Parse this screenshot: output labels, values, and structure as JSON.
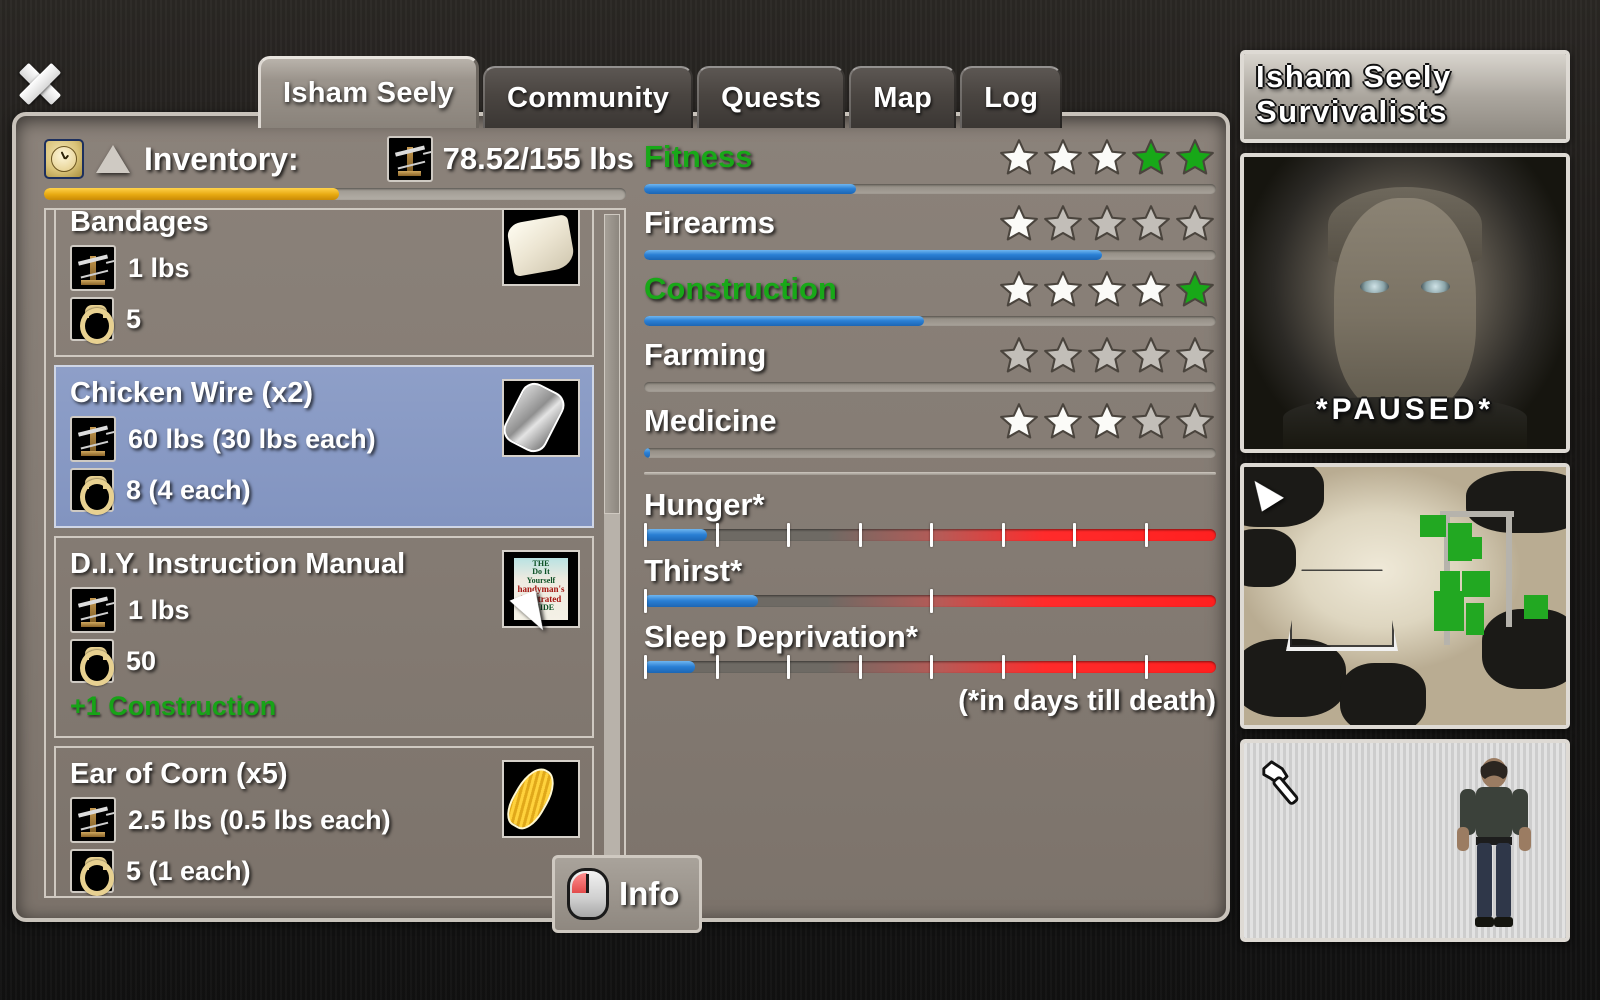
{
  "window": {
    "close_label": "close-window"
  },
  "tabs": [
    {
      "label": "Isham Seely",
      "active": true
    },
    {
      "label": "Community",
      "active": false
    },
    {
      "label": "Quests",
      "active": false
    },
    {
      "label": "Map",
      "active": false
    },
    {
      "label": "Log",
      "active": false
    }
  ],
  "inventory": {
    "title": "Inventory:",
    "weight_text": "78.52/155 lbs",
    "weight_current": 78.52,
    "weight_max": 155,
    "weight_percent": 50.7,
    "clock_icon": "clock-icon",
    "sort_icon": "sort-triangle-icon",
    "scale_icon": "scale-icon",
    "items": [
      {
        "name": "Bandages",
        "weight": "1 lbs",
        "value": "5",
        "bonus": "",
        "thumb": "bandage-thumb",
        "selected": false
      },
      {
        "name": "Chicken Wire (x2)",
        "weight": "60 lbs (30 lbs each)",
        "value": "8 (4 each)",
        "bonus": "",
        "thumb": "chicken-wire-thumb",
        "selected": true
      },
      {
        "name": "D.I.Y. Instruction Manual",
        "weight": "1 lbs",
        "value": "50",
        "bonus": "+1 Construction",
        "thumb": "manual-thumb",
        "selected": false
      },
      {
        "name": "Ear of Corn (x5)",
        "weight": "2.5 lbs (0.5 lbs each)",
        "value": "5 (1 each)",
        "bonus": "",
        "thumb": "corn-thumb",
        "selected": false
      }
    ]
  },
  "skills": [
    {
      "name": "Fitness",
      "boosted": true,
      "stars_filled": 5,
      "stars_green": 2,
      "progress_percent": 37
    },
    {
      "name": "Firearms",
      "boosted": false,
      "stars_filled": 1,
      "stars_green": 0,
      "progress_percent": 80
    },
    {
      "name": "Construction",
      "boosted": true,
      "stars_filled": 5,
      "stars_green": 1,
      "progress_percent": 49
    },
    {
      "name": "Farming",
      "boosted": false,
      "stars_filled": 0,
      "stars_green": 0,
      "progress_percent": 0
    },
    {
      "name": "Medicine",
      "boosted": false,
      "stars_filled": 3,
      "stars_green": 0,
      "progress_percent": 1
    }
  ],
  "vitals": [
    {
      "name": "Hunger*",
      "fill_percent": 11,
      "ticks": 7
    },
    {
      "name": "Thirst*",
      "fill_percent": 20,
      "ticks": 1
    },
    {
      "name": "Sleep Deprivation*",
      "fill_percent": 9,
      "ticks": 7
    }
  ],
  "vitals_note": "(*in days till death)",
  "info_button": {
    "label": "Info",
    "icon": "mouse-left-click-icon"
  },
  "sidebar": {
    "character_name": "Isham Seely",
    "faction": "Survivalists",
    "paused_text": "*PAUSED*",
    "equipped_icon": "hammer-icon"
  },
  "colors": {
    "panel_bg": "#847b73",
    "accent_green": "#18a818",
    "selection_blue": "#8294c0",
    "weight_bar": "#e7a911",
    "skill_bar": "#2a7fd4",
    "danger_red": "#ff2b2b"
  }
}
